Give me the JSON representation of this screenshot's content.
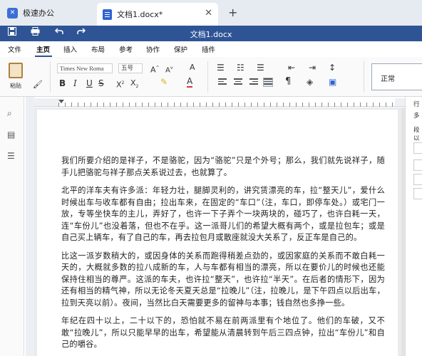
{
  "titlebar": {
    "app_tab_label": "极速办公",
    "doc_tab_label": "文档1.docx*",
    "close_glyph": "✕",
    "new_tab_glyph": "+"
  },
  "quickbar": {
    "doc_title": "文档1.docx",
    "icons": [
      "save-icon",
      "print-icon",
      "undo-icon",
      "redo-icon"
    ]
  },
  "menu": {
    "items": [
      "文件",
      "主页",
      "插入",
      "布局",
      "参考",
      "协作",
      "保护",
      "插件"
    ],
    "active": "主页"
  },
  "ribbon": {
    "paste_label": "粘贴",
    "font_name": "Times New Roma",
    "font_size": "五号",
    "style_value": "正常"
  },
  "right_panel": {
    "labels": [
      "行",
      "多",
      "段",
      "以"
    ]
  },
  "document": {
    "paragraphs": [
      "我们所要介绍的是祥子，不是骆驼，因为“骆驼”只是个外号；那么，我们就先说祥子，随手儿把骆驼与祥子那点关系说过去，也就算了。",
      "北平的洋车夫有许多派：年轻力壮，腿脚灵利的，讲究赁漂亮的车，拉“整天儿”，爱什么时候出车与收车都有自由；拉出车来，在固定的“车口”（注，车口，即停车处。）或宅门一放，专等坐快车的主儿，弄好了，也许一下子弄个一块两块的，碰巧了，也许白耗一天，连“车份儿”也没着落，但也不在乎。这一派哥儿们的希望大概有两个，或是拉包车；或是自己买上辆车，有了自己的车，再去拉包月或散座就没大关系了，反正车是自己的。",
      "比这一派岁数稍大的，或因身体的关系而跑得稍差点劲的，或因家庭的关系而不敢白耗一天的，大概就多数的拉八成新的车，人与车都有相当的漂亮，所以在要价儿的时候也还能保持住相当的尊严。这派的车夫，也许拉“整天”，也许拉“半天”。在后者的情形下，因为还有相当的精气神，所以无论冬天夏天总是“拉晚儿”（注，拉晚儿，是下午四点以后出车，拉到天亮以前）。夜间，当然比白天需要更多的留神与本事；钱自然也多挣一些。",
      "年纪在四十以上，二十以下的，恐怕就不易在前两派里有个地位了。他们的车破，又不敢“拉晚儿”，所以只能早早的出车，希望能从清晨转到午后三四点钟，拉出“车份儿”和自己的嚼谷。"
    ]
  }
}
